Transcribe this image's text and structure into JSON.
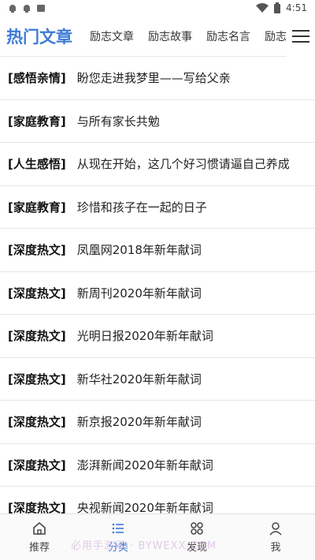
{
  "status": {
    "time": "4:51",
    "icons": [
      "app-notification-icon",
      "app-notification-icon",
      "app-notification-icon",
      "wifi-icon",
      "battery-icon"
    ]
  },
  "tabs": {
    "items": [
      {
        "label": "热门文章",
        "active": true
      },
      {
        "label": "励志文章",
        "active": false
      },
      {
        "label": "励志故事",
        "active": false
      },
      {
        "label": "励志名言",
        "active": false
      },
      {
        "label": "励志",
        "active": false
      }
    ],
    "menu_icon": "hamburger-menu-icon"
  },
  "articles": [
    {
      "category": "[感悟亲情]",
      "title": "盼您走进我梦里——写给父亲"
    },
    {
      "category": "[家庭教育]",
      "title": "与所有家长共勉"
    },
    {
      "category": "[人生感悟]",
      "title": "从现在开始，这几个好习惯请逼自己养成"
    },
    {
      "category": "[家庭教育]",
      "title": "珍惜和孩子在一起的日子"
    },
    {
      "category": "[深度热文]",
      "title": "凤凰网2018年新年献词"
    },
    {
      "category": "[深度热文]",
      "title": "新周刊2020年新年献词"
    },
    {
      "category": "[深度热文]",
      "title": "光明日报2020年新年献词"
    },
    {
      "category": "[深度热文]",
      "title": "新华社2020年新年献词"
    },
    {
      "category": "[深度热文]",
      "title": "新京报2020年新年献词"
    },
    {
      "category": "[深度热文]",
      "title": "澎湃新闻2020年新年献词"
    },
    {
      "category": "[深度热文]",
      "title": "央视新闻2020年新年献词"
    }
  ],
  "bottom_nav": [
    {
      "label": "推荐",
      "icon": "home-icon",
      "active": false
    },
    {
      "label": "分类",
      "icon": "list-icon",
      "active": true
    },
    {
      "label": "发现",
      "icon": "grid-icon",
      "active": false
    },
    {
      "label": "我",
      "icon": "user-icon",
      "active": false
    }
  ],
  "watermark": "必用手游网 · BYWEXX.COM",
  "colors": {
    "accent": "#3e7bd6",
    "text": "#222222",
    "divider": "#e5e5e5"
  }
}
